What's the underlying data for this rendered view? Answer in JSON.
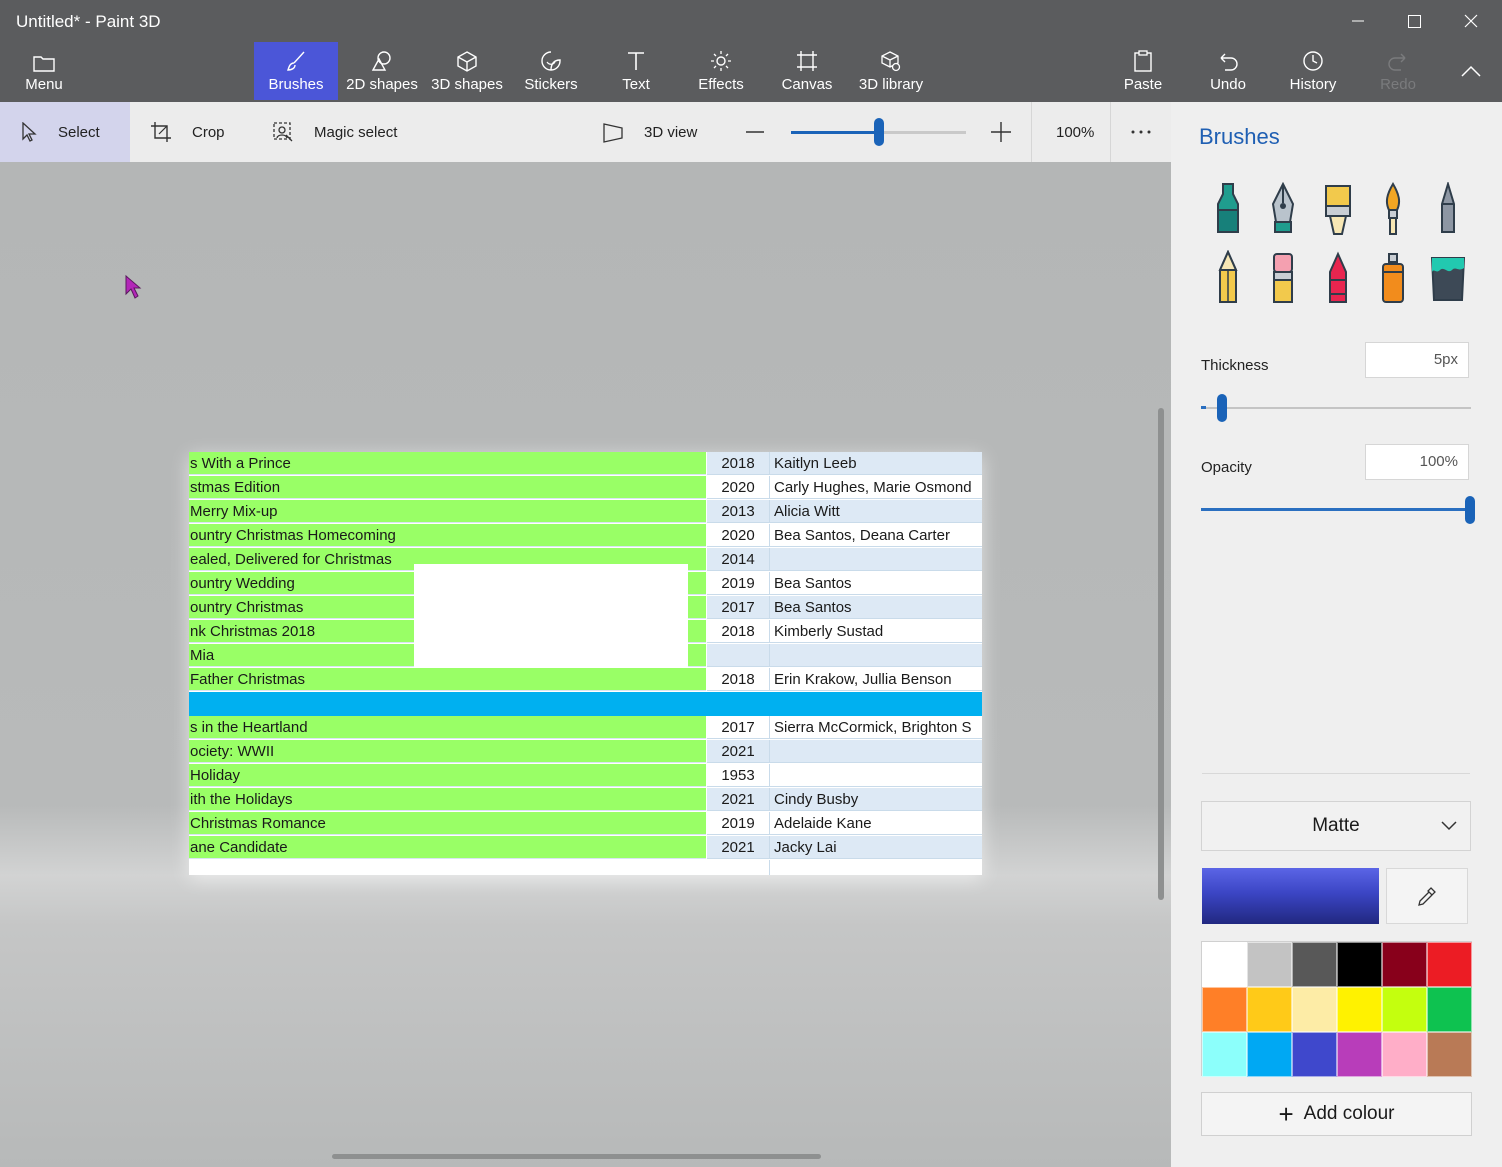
{
  "window": {
    "title": "Untitled* - Paint 3D"
  },
  "ribbon": {
    "menu": "Menu",
    "brushes": "Brushes",
    "shapes2d": "2D shapes",
    "shapes3d": "3D shapes",
    "stickers": "Stickers",
    "text": "Text",
    "effects": "Effects",
    "canvas": "Canvas",
    "library3d": "3D library",
    "paste": "Paste",
    "undo": "Undo",
    "history": "History",
    "redo": "Redo"
  },
  "toolbar": {
    "select": "Select",
    "crop": "Crop",
    "magic_select": "Magic select",
    "view3d": "3D view",
    "zoom_value": "100%",
    "zoom_level": 0.5
  },
  "sheet": {
    "rows": [
      {
        "title": "s With a Prince",
        "year": "2018",
        "cast": "Kaitlyn Leeb",
        "alt": true
      },
      {
        "title": "stmas Edition",
        "year": "2020",
        "cast": "Carly Hughes, Marie Osmond",
        "alt": false
      },
      {
        "title": "Merry Mix-up",
        "year": "2013",
        "cast": "Alicia Witt",
        "alt": true
      },
      {
        "title": "ountry Christmas Homecoming",
        "year": "2020",
        "cast": "Bea Santos, Deana Carter",
        "alt": false
      },
      {
        "title": "ealed, Delivered for Christmas",
        "year": "2014",
        "cast": "",
        "alt": true
      },
      {
        "title": "ountry Wedding",
        "year": "2019",
        "cast": "Bea Santos",
        "alt": false
      },
      {
        "title": "ountry Christmas",
        "year": "2017",
        "cast": "Bea Santos",
        "alt": true
      },
      {
        "title": "nk Christmas 2018",
        "year": "2018",
        "cast": "Kimberly Sustad",
        "alt": false
      },
      {
        "title": " Mia",
        "year": "",
        "cast": "",
        "alt": true
      },
      {
        "title": " Father Christmas",
        "year": "2018",
        "cast": "Erin Krakow, Jullia Benson",
        "alt": false
      },
      {
        "separator": true
      },
      {
        "title": "s in the Heartland",
        "year": "2017",
        "cast": "Sierra McCormick, Brighton S",
        "alt": false
      },
      {
        "title": "ociety: WWII",
        "year": "2021",
        "cast": "",
        "alt": true
      },
      {
        "title": "Holiday",
        "year": "1953",
        "cast": "",
        "alt": false
      },
      {
        "title": "ith the Holidays",
        "year": "2021",
        "cast": "Cindy Busby",
        "alt": true
      },
      {
        "title": "Christmas Romance",
        "year": "2019",
        "cast": "Adelaide Kane",
        "alt": false
      },
      {
        "title": "ane Candidate",
        "year": "2021",
        "cast": "Jacky Lai",
        "alt": true
      }
    ]
  },
  "panel": {
    "title": "Brushes",
    "brushes": [
      "marker-icon",
      "calligraphy-pen-icon",
      "oil-brush-icon",
      "watercolor-icon",
      "pixel-pen-icon",
      "pencil-icon",
      "eraser-icon",
      "crayon-icon",
      "spray-can-icon",
      "fill-bucket-icon"
    ],
    "thickness_label": "Thickness",
    "thickness_value": "5px",
    "thickness_level": 0.02,
    "opacity_label": "Opacity",
    "opacity_value": "100%",
    "opacity_level": 1.0,
    "finish": "Matte",
    "current_color": "#3b45c4",
    "palette": [
      "#ffffff",
      "#c3c3c3",
      "#585858",
      "#000000",
      "#88001b",
      "#ec1c24",
      "#ff7f27",
      "#ffca18",
      "#fdeca6",
      "#fff200",
      "#c4ff0e",
      "#0ec250",
      "#8cfffb",
      "#00a8f3",
      "#3f48cc",
      "#b83dba",
      "#ffaec8",
      "#b97a56"
    ],
    "add_colour": "Add colour"
  }
}
